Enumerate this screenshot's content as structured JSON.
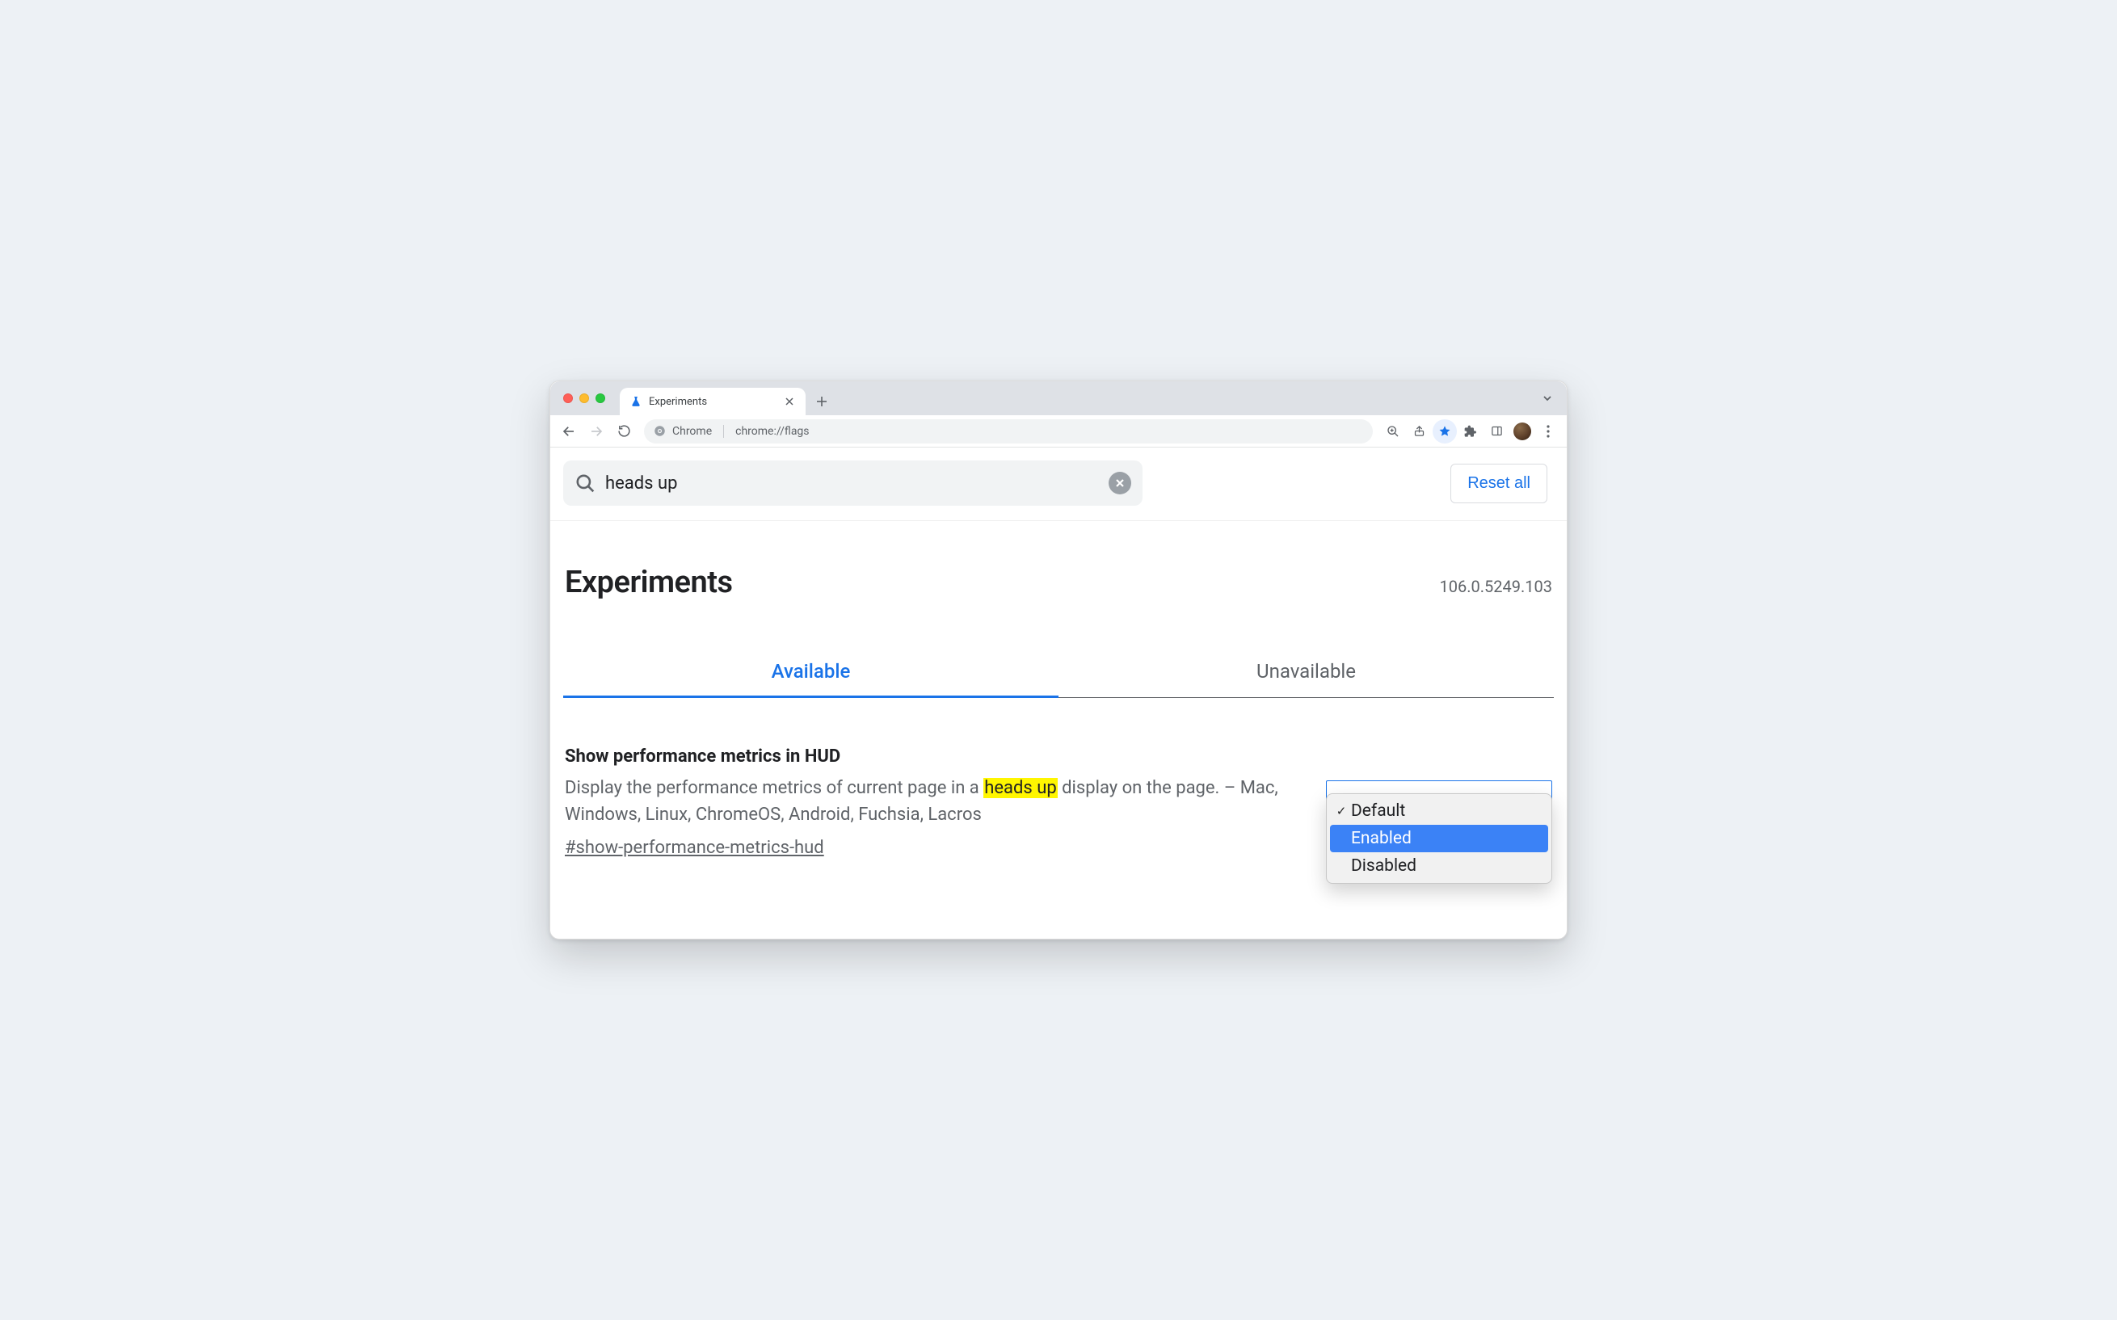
{
  "window": {
    "traffic_light_colors": {
      "close": "#ff5f57",
      "minimize": "#febc2e",
      "zoom": "#28c840"
    }
  },
  "tabstrip": {
    "tab_title": "Experiments"
  },
  "toolbar": {
    "security_label": "Chrome",
    "url": "chrome://flags"
  },
  "search": {
    "value": "heads up"
  },
  "header": {
    "reset_label": "Reset all",
    "title": "Experiments",
    "version": "106.0.5249.103"
  },
  "tabs": {
    "available": "Available",
    "unavailable": "Unavailable"
  },
  "flag": {
    "title": "Show performance metrics in HUD",
    "description_pre": "Display the performance metrics of current page in a ",
    "description_hl": "heads up",
    "description_post": " display on the page. – Mac, Windows, Linux, ChromeOS, Android, Fuchsia, Lacros",
    "anchor": "#show-performance-metrics-hud",
    "options": {
      "default": "Default",
      "enabled": "Enabled",
      "disabled": "Disabled"
    }
  }
}
